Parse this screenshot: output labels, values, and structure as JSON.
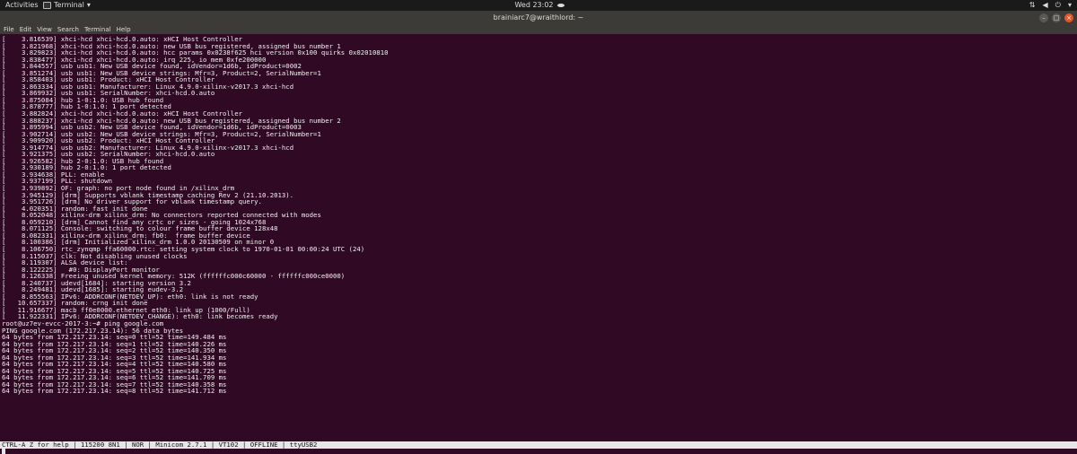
{
  "topbar": {
    "activities": "Activities",
    "app_name": "Terminal",
    "clock": "Wed 23:02",
    "tray_icons": [
      "network-icon",
      "volume-icon",
      "power-icon"
    ]
  },
  "window": {
    "title": "brainiarc7@wraithlord: ~",
    "close_glyph": "×"
  },
  "menu": [
    "File",
    "Edit",
    "View",
    "Search",
    "Terminal",
    "Help"
  ],
  "terminal": {
    "lines": [
      "[    3.816539] xhci-hcd xhci-hcd.0.auto: xHCI Host Controller",
      "[    3.821968] xhci-hcd xhci-hcd.0.auto: new USB bus registered, assigned bus number 1",
      "[    3.829823] xhci-hcd xhci-hcd.0.auto: hcc params 0x0238f625 hci version 0x100 quirks 0x02010810",
      "[    3.838477] xhci-hcd xhci-hcd.0.auto: irq 225, io mem 0xfe200000",
      "[    3.844557] usb usb1: New USB device found, idVendor=1d6b, idProduct=0002",
      "[    3.851274] usb usb1: New USB device strings: Mfr=3, Product=2, SerialNumber=1",
      "[    3.858403] usb usb1: Product: xHCI Host Controller",
      "[    3.863334] usb usb1: Manufacturer: Linux 4.9.0-xilinx-v2017.3 xhci-hcd",
      "[    3.869932] usb usb1: SerialNumber: xhci-hcd.0.auto",
      "[    3.875084] hub 1-0:1.0: USB hub found",
      "[    3.878777] hub 1-0:1.0: 1 port detected",
      "[    3.882824] xhci-hcd xhci-hcd.0.auto: xHCI Host Controller",
      "[    3.888237] xhci-hcd xhci-hcd.0.auto: new USB bus registered, assigned bus number 2",
      "[    3.895994] usb usb2: New USB device found, idVendor=1d6b, idProduct=0003",
      "[    3.902714] usb usb2: New USB device strings: Mfr=3, Product=2, SerialNumber=1",
      "[    3.909920] usb usb2: Product: xHCI Host Controller",
      "[    3.914774] usb usb2: Manufacturer: Linux 4.9.0-xilinx-v2017.3 xhci-hcd",
      "[    3.921375] usb usb2: SerialNumber: xhci-hcd.0.auto",
      "[    3.926582] hub 2-0:1.0: USB hub found",
      "[    3.930189] hub 2-0:1.0: 1 port detected",
      "[    3.934638] PLL: enable",
      "[    3.937199] PLL: shutdown",
      "[    3.939892] OF: graph: no port node found in /xilinx_drm",
      "[    3.945129] [drm] Supports vblank timestamp caching Rev 2 (21.10.2013).",
      "[    3.951726] [drm] No driver support for vblank timestamp query.",
      "[    4.020351] random: fast init done",
      "[    8.052048] xilinx-drm xilinx_drm: No connectors reported connected with modes",
      "[    8.059210] [drm] Cannot find any crtc or sizes - going 1024x768",
      "[    8.071125] Console: switching to colour frame buffer device 128x48",
      "[    8.082331] xilinx-drm xilinx_drm: fb0:  frame buffer device",
      "[    8.100386] [drm] Initialized xilinx_drm 1.0.0 20130509 on minor 0",
      "[    8.106750] rtc_zynqmp ffa60000.rtc: setting system clock to 1970-01-01 00:00:24 UTC (24)",
      "[    8.115037] clk: Not disabling unused clocks",
      "[    8.119307] ALSA device list:",
      "[    8.122225]   #0: DisplayPort monitor",
      "[    8.126338] Freeing unused kernel memory: 512K (ffffffc000c60000 - ffffffc000ce0000)",
      "[    8.240737] udevd[1684]: starting version 3.2",
      "[    8.249481] udevd[1685]: starting eudev-3.2",
      "[    8.855563] IPv6: ADDRCONF(NETDEV_UP): eth0: link is not ready",
      "[   10.657337] random: crng init done",
      "[   11.916677] macb ff0e0000.ethernet eth0: link up (1000/Full)",
      "[   11.922331] IPv6: ADDRCONF(NETDEV_CHANGE): eth0: link becomes ready",
      "root@uz7ev-evcc-2017-3:~# ping google.com",
      "PING google.com (172.217.23.14): 56 data bytes",
      "64 bytes from 172.217.23.14: seq=0 ttl=52 time=149.484 ms",
      "64 bytes from 172.217.23.14: seq=1 ttl=52 time=140.226 ms",
      "64 bytes from 172.217.23.14: seq=2 ttl=52 time=140.350 ms",
      "64 bytes from 172.217.23.14: seq=3 ttl=52 time=141.934 ms",
      "64 bytes from 172.217.23.14: seq=4 ttl=52 time=140.580 ms",
      "64 bytes from 172.217.23.14: seq=5 ttl=52 time=140.725 ms",
      "64 bytes from 172.217.23.14: seq=6 ttl=52 time=141.709 ms",
      "64 bytes from 172.217.23.14: seq=7 ttl=52 time=140.358 ms",
      "64 bytes from 172.217.23.14: seq=8 ttl=52 time=141.712 ms"
    ]
  },
  "statusbar": "CTRL-A Z for help | 115200 8N1 | NOR | Minicom 2.7.1 | VT102 | OFFLINE | ttyUSB2"
}
